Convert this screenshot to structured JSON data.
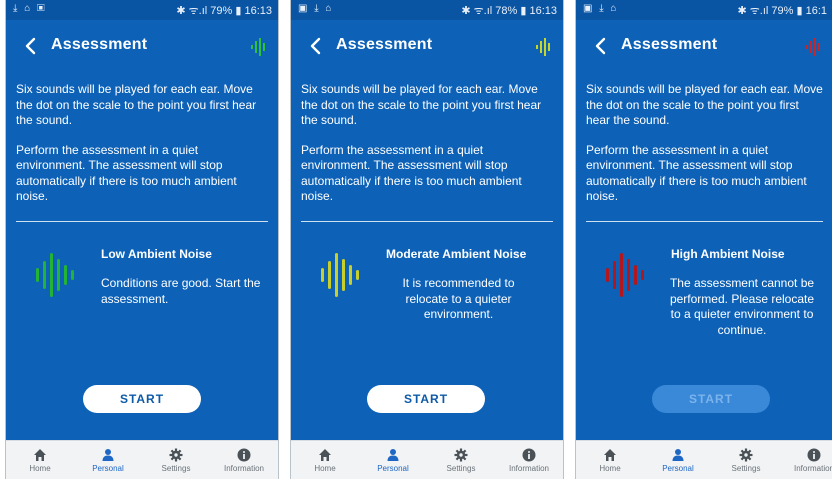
{
  "screens": [
    {
      "status": {
        "left_icons": "⤓ ⌂ ▣",
        "right": "✱ ᯤ.ıl 79% ▮ 16:13"
      },
      "header": {
        "title": "Assessment",
        "noise_color": "#2fbf3a"
      },
      "instructions": {
        "p1": "Six sounds will be played for each ear. Move the dot on the scale to the point you first hear the sound.",
        "p2": " Perform the assessment in a quiet environment. The assessment will stop automatically if there is too much ambient noise."
      },
      "noise_level": {
        "title": "Low Ambient Noise",
        "text": "Conditions are good. Start the assessment.",
        "color": "#23b335",
        "icon": "sound-wave-icon"
      },
      "start_label": "START",
      "start_enabled": true,
      "nav": {
        "items": [
          "Home",
          "Personal",
          "Settings",
          "Information"
        ],
        "active": "Personal"
      }
    },
    {
      "status": {
        "left_icons": "▣ ⤓ ⌂",
        "right": "✱ ᯤ.ıl 78% ▮ 16:13"
      },
      "header": {
        "title": "Assessment",
        "noise_color": "#c8d52b"
      },
      "instructions": {
        "p1": "Six sounds will be played for each ear. Move the dot on the scale to the point you first hear the sound.",
        "p2": " Perform the assessment in a quiet environment. The assessment will stop automatically if there is too much ambient noise."
      },
      "noise_level": {
        "title": "Moderate Ambient Noise",
        "text": "It is recommended to relocate to a quieter environment.",
        "color": "#c9cf2a",
        "icon": "sound-wave-icon"
      },
      "start_label": "START",
      "start_enabled": true,
      "nav": {
        "items": [
          "Home",
          "Personal",
          "Settings",
          "Information"
        ],
        "active": "Personal"
      }
    },
    {
      "status": {
        "left_icons": "▣ ⤓ ⌂",
        "right": "✱ ᯤ.ıl 79% ▮ 16:1"
      },
      "header": {
        "title": "Assessment",
        "noise_color": "#c1272d"
      },
      "instructions": {
        "p1": "Six sounds will be played for each ear. Move the dot on the scale to the point you first hear the sound.",
        "p2": " Perform the assessment in a quiet environment. The assessment will stop automatically if there is too much ambient noise."
      },
      "noise_level": {
        "title": "High Ambient Noise",
        "text": "The assessment cannot be performed. Please relocate to a quieter environment to continue.",
        "color": "#b3161c",
        "icon": "sound-wave-icon"
      },
      "start_label": "START",
      "start_enabled": false,
      "nav": {
        "items": [
          "Home",
          "Personal",
          "Settings",
          "Information"
        ],
        "active": "Personal"
      }
    }
  ]
}
